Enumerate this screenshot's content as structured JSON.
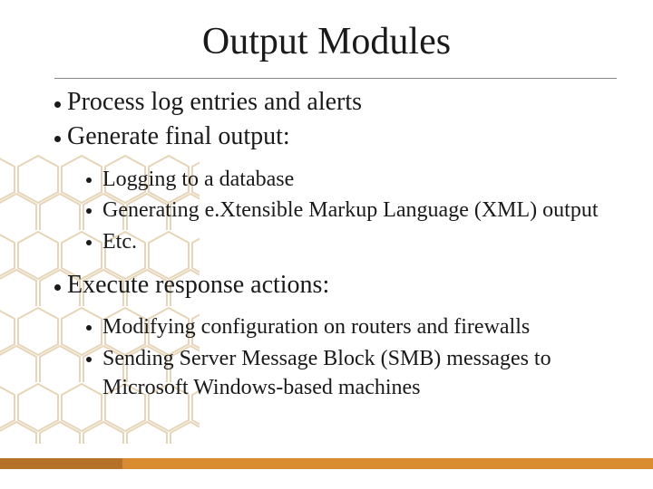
{
  "title": "Output Modules",
  "bullets": {
    "b1": "Process log entries and alerts",
    "b2": "Generate final output:",
    "b2a": "Logging to a database",
    "b2b": "Generating e.Xtensible Markup Language (XML) output",
    "b2c": "Etc.",
    "b3": "Execute response actions:",
    "b3a": "Modifying configuration on routers and firewalls",
    "b3b": "Sending Server Message Block (SMB) messages to Microsoft Windows-based machines"
  }
}
